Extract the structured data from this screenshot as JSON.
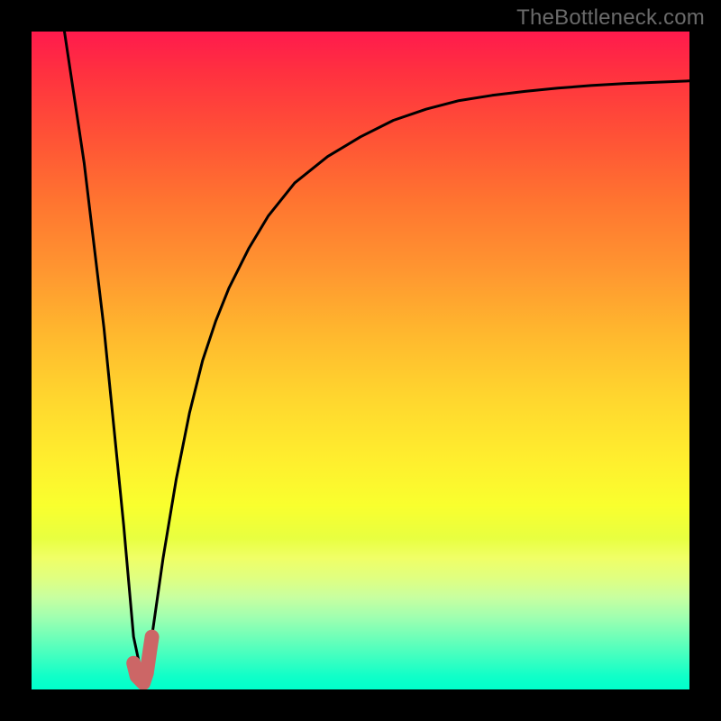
{
  "watermark": "TheBottleneck.com",
  "chart_data": {
    "type": "line",
    "title": "",
    "xlabel": "",
    "ylabel": "",
    "xlim": [
      0,
      100
    ],
    "ylim": [
      0,
      100
    ],
    "series": [
      {
        "name": "black-curve",
        "x": [
          5,
          8,
          11,
          14,
          15.5,
          17,
          18,
          20,
          22,
          24,
          26,
          28,
          30,
          33,
          36,
          40,
          45,
          50,
          55,
          60,
          65,
          70,
          75,
          80,
          85,
          90,
          95,
          100
        ],
        "values": [
          100,
          80,
          55,
          25,
          8,
          1,
          6,
          20,
          32,
          42,
          50,
          56,
          61,
          67,
          72,
          77,
          81,
          84,
          86.5,
          88.2,
          89.5,
          90.3,
          90.9,
          91.4,
          91.8,
          92.1,
          92.3,
          92.5
        ]
      },
      {
        "name": "highlight-segment",
        "x": [
          15.5,
          16,
          17,
          17.5,
          18,
          18.3
        ],
        "values": [
          4,
          2,
          1,
          2.5,
          6,
          8
        ]
      }
    ],
    "background_gradient": {
      "top": "#ff1a4d",
      "middle": "#ffd72e",
      "bottom": "#00ffcc"
    }
  }
}
